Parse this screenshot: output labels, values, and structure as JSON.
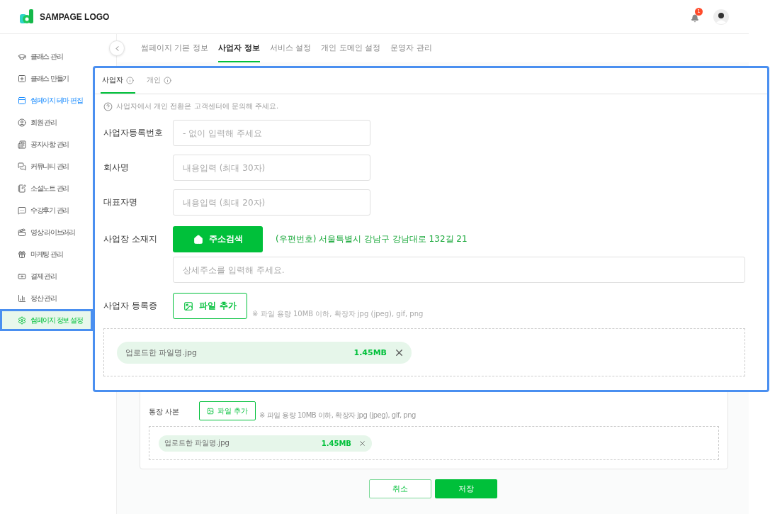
{
  "header": {
    "logo_text": "SAMPAGE LOGO",
    "notification_count": "1"
  },
  "sidebar": {
    "items": [
      {
        "label": "클래스 관리",
        "selected": false,
        "hovered": false
      },
      {
        "label": "클래스 만들기",
        "selected": false,
        "hovered": false
      },
      {
        "label": "썸페이지 테마 편집",
        "selected": false,
        "hovered": true
      },
      {
        "label": "회원 관리",
        "selected": false,
        "hovered": false
      },
      {
        "label": "공지사항 관리",
        "selected": false,
        "hovered": false
      },
      {
        "label": "커뮤니티 관리",
        "selected": false,
        "hovered": false
      },
      {
        "label": "소셜노트 관리",
        "selected": false,
        "hovered": false
      },
      {
        "label": "수강후기 관리",
        "selected": false,
        "hovered": false
      },
      {
        "label": "영상 라이브러리",
        "selected": false,
        "hovered": false
      },
      {
        "label": "마케팅 관리",
        "selected": false,
        "hovered": false
      },
      {
        "label": "결제 관리",
        "selected": false,
        "hovered": false
      },
      {
        "label": "정산 관리",
        "selected": false,
        "hovered": false
      },
      {
        "label": "썸페이지 정보 설정",
        "selected": true,
        "hovered": false
      }
    ]
  },
  "tabs": [
    {
      "label": "썸페이지 기본 정보",
      "selected": false
    },
    {
      "label": "사업자 정보",
      "selected": true
    },
    {
      "label": "서비스 설정",
      "selected": false
    },
    {
      "label": "개인 도메인 설정",
      "selected": false
    },
    {
      "label": "운영자 관리",
      "selected": false
    }
  ],
  "panel": {
    "subtabs": [
      {
        "label": "사업자",
        "selected": true
      },
      {
        "label": "개인",
        "selected": false
      }
    ],
    "notice": "사업자에서 개인 전환은 고객센터에 문의해 주세요.",
    "fields": [
      {
        "label": "사업자등록번호",
        "placeholder": "- 없이 입력해 주세요"
      },
      {
        "label": "회사명",
        "placeholder": "내용입력 (최대 30자)"
      },
      {
        "label": "대표자명",
        "placeholder": "내용입력 (최대 20자)"
      }
    ],
    "address": {
      "label": "사업장 소재지",
      "button": "주소검색",
      "value": "(우편번호) 서울특별시 강남구 강남대로 132길 21",
      "detail_placeholder": "상세주소를 입력해 주세요."
    },
    "upload": {
      "label": "사업자 등록증",
      "button": "파일 추가",
      "hint": "※ 파일 용량 10MB 이하, 확장자 jpg (jpeg), gif, png",
      "file_name": "업로드한 파일명.jpg",
      "file_size": "1.45MB"
    }
  },
  "bank_upload": {
    "label": "통장 사본",
    "button": "파일 추가",
    "hint": "※ 파일 용량 10MB 이하, 확장자 jpg (jpeg), gif, png",
    "file_name": "업로드한 파일명.jpg",
    "file_size": "1.45MB"
  },
  "actions": {
    "cancel": "취소",
    "save": "저장"
  }
}
